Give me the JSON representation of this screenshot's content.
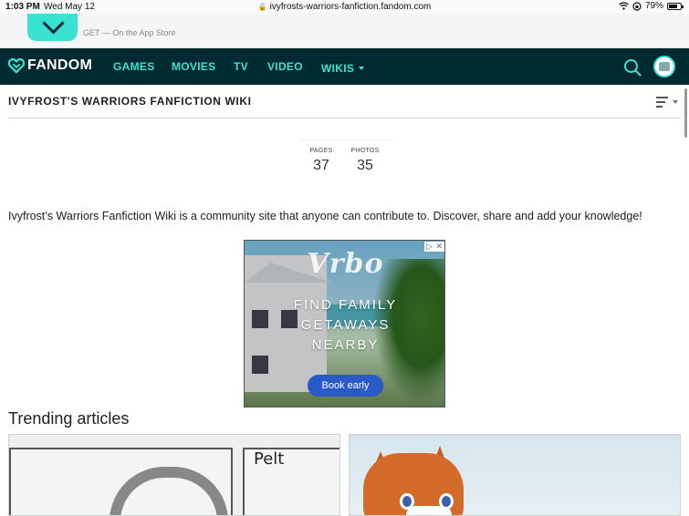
{
  "status_bar": {
    "time": "1:03 PM",
    "date": "Wed May 12",
    "url": "ivyfrosts-warriors-fanfiction.fandom.com",
    "battery": "79%",
    "battery_level": 0.79
  },
  "app_banner": {
    "store_text": "GET — On the App Store"
  },
  "fandom_nav": {
    "logo": "FANDOM",
    "links": [
      "GAMES",
      "MOVIES",
      "TV",
      "VIDEO",
      "WIKIS"
    ]
  },
  "wiki": {
    "title": "IVYFROST'S WARRIORS FANFICTION WIKI",
    "stats": {
      "pages_label": "PAGES",
      "pages_value": "37",
      "photos_label": "PHOTOS",
      "photos_value": "35"
    },
    "description": "Ivyfrost’s Warriors Fanfiction Wiki is a community site that anyone can contribute to. Discover, share and add your knowledge!"
  },
  "ad": {
    "brand": "Vrbo",
    "headline_lines": [
      "FIND FAMILY",
      "GETAWAYS",
      "NEARBY"
    ],
    "cta": "Book early"
  },
  "trending": {
    "title": "Trending articles",
    "card_one_caption": "Pelt"
  },
  "colors": {
    "nav_bg": "#002a32",
    "accent": "#3ae2d2",
    "ad_cta": "#2a59c8"
  }
}
